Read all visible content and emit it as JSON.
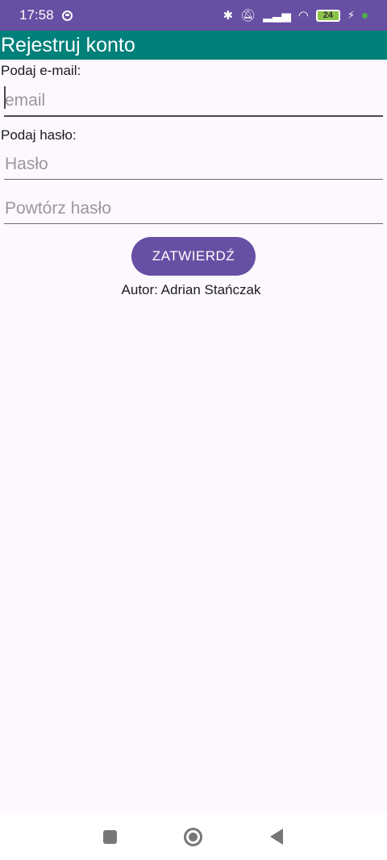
{
  "status_bar": {
    "time": "17:58",
    "battery_level": "24",
    "accent_color": "#674fa3",
    "icons": [
      "sync-icon",
      "bluetooth-icon",
      "bell-off-icon",
      "signal-icon",
      "wifi-icon",
      "battery-icon",
      "charge-icon"
    ]
  },
  "app_bar": {
    "title": "Rejestruj konto",
    "color": "#00807a"
  },
  "form": {
    "email_label": "Podaj e-mail:",
    "email_placeholder": "email",
    "password_label": "Podaj hasło:",
    "password_placeholder": "Hasło",
    "repeat_password_placeholder": "Powtórz hasło",
    "submit_label": "ZATWIERDŹ",
    "submit_color": "#6750a4"
  },
  "footer": {
    "author": "Autor: Adrian Stańczak"
  },
  "nav_bar": {
    "icons": [
      "recents-square-icon",
      "home-circle-icon",
      "back-triangle-icon"
    ]
  }
}
